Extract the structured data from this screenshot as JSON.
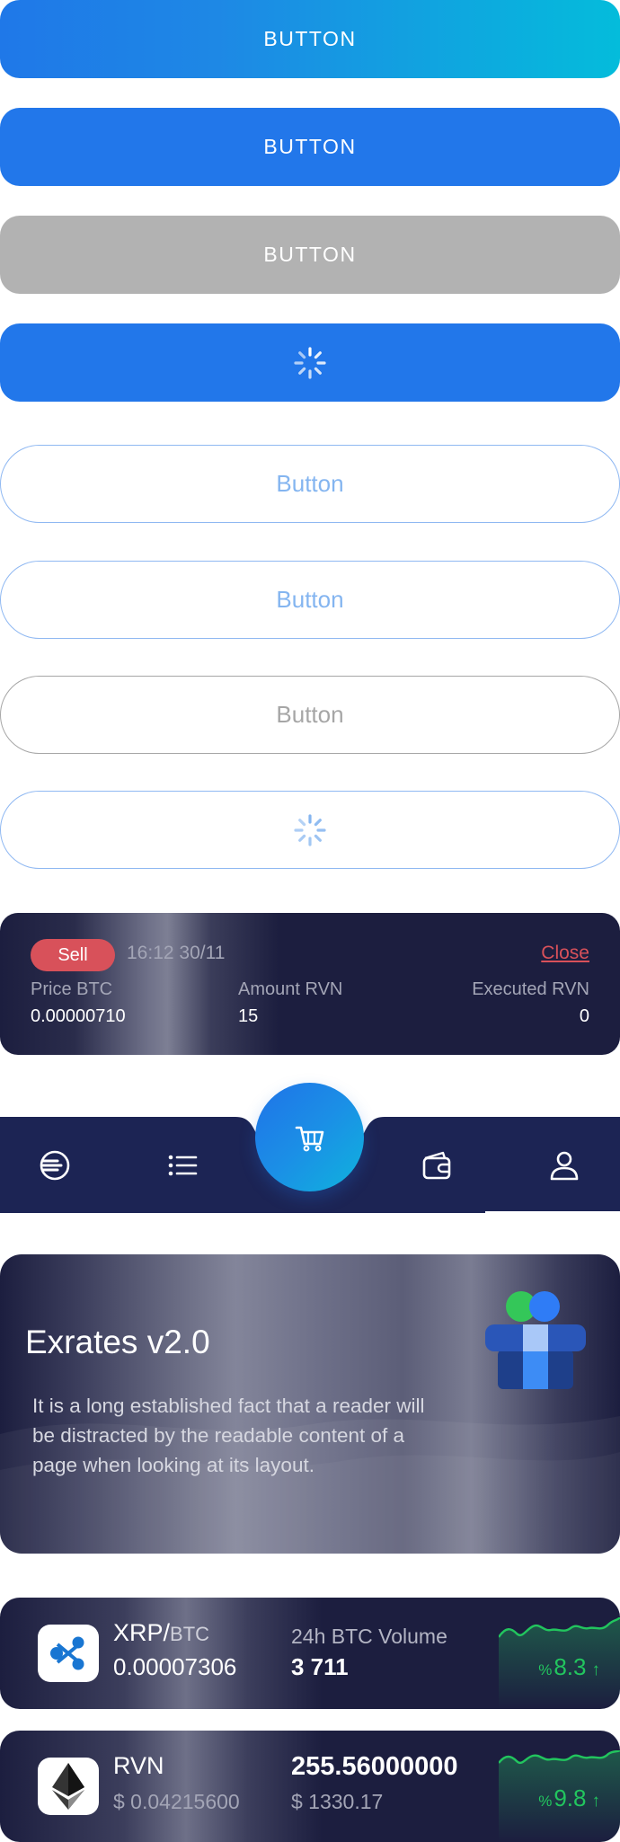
{
  "buttons": {
    "gradient_label": "BUTTON",
    "primary_label": "BUTTON",
    "disabled_label": "BUTTON",
    "outline_1_label": "Button",
    "outline_2_label": "Button",
    "outline_disabled_label": "Button"
  },
  "order": {
    "side": "Sell",
    "time": "16:12  30/11",
    "close_label": "Close",
    "price_label": "Price BTC",
    "price_value": "0.00000710",
    "amount_label": "Amount RVN",
    "amount_value": "15",
    "executed_label": "Executed RVN",
    "executed_value": "0"
  },
  "nav": {
    "items": [
      "exchange-icon",
      "list-icon",
      "cart-icon",
      "wallet-icon",
      "profile-icon"
    ],
    "active": "cart-icon"
  },
  "promo": {
    "title": "Exrates v2.0",
    "text": "It is a long established fact that a reader will be distracted by the readable content of a page when looking at its layout."
  },
  "tickers": [
    {
      "pair_base": "XRP/",
      "pair_quote": "BTC",
      "price": "0.00007306",
      "volume_label": "24h BTC Volume",
      "volume_value": "3 711",
      "change_pct_sign": "%",
      "change_value": "8.3",
      "change_arrow": "↑",
      "icon": "ripple-icon"
    },
    {
      "pair_base": "RVN",
      "price_usd": "$ 0.04215600",
      "amount": "255.56000000",
      "amount_usd": "$ 1330.17",
      "change_pct_sign": "%",
      "change_value": "9.8",
      "change_arrow": "↑",
      "icon": "ethereum-icon"
    }
  ],
  "colors": {
    "primary": "#2277ea",
    "gradient_end": "#04bcdb",
    "disabled": "#b2b2b2",
    "navy": "#1c1e3f",
    "sell": "#d8515a",
    "up": "#22c55e"
  }
}
